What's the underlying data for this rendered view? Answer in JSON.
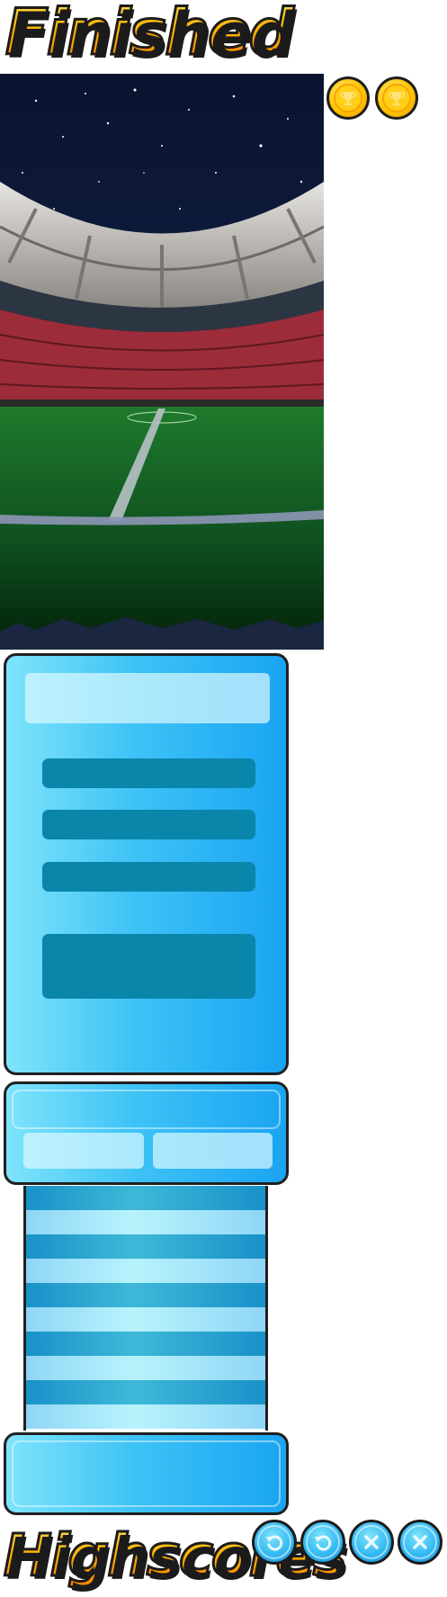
{
  "titles": {
    "finished": "Finished",
    "highscores": "Highscores"
  },
  "icons": {
    "trophy_coin": "trophy-icon",
    "restart": "restart-icon",
    "close": "close-icon"
  },
  "colors": {
    "title_fill": "#ffb300",
    "title_outline": "#1b1b1b",
    "panel_light": "#7fe4fb",
    "panel_dark": "#1aa4f2",
    "bar_dark": "#0a86aa",
    "coin": "#ffc400",
    "pitch": "#1f7a2c",
    "sky": "#0b1838"
  }
}
